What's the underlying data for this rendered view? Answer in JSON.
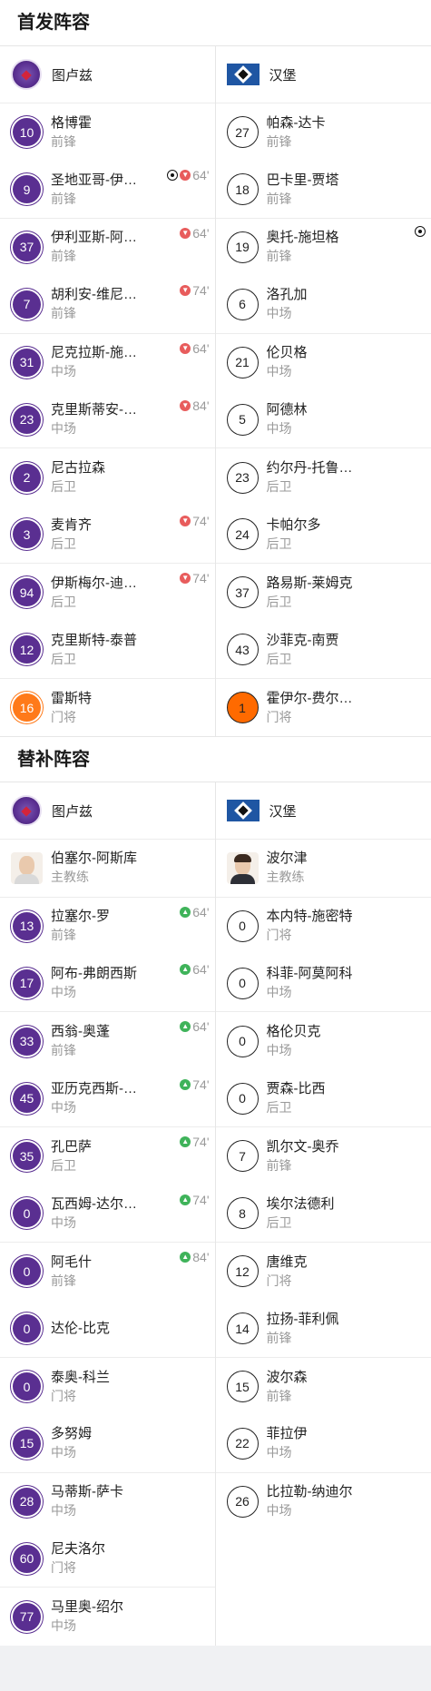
{
  "starting": {
    "title": "首发阵容",
    "home": {
      "team": "图卢兹",
      "players": [
        {
          "num": "10",
          "name": "格博霍",
          "pos": "前锋",
          "events": []
        },
        {
          "num": "9",
          "name": "圣地亚哥-伊…",
          "pos": "前锋",
          "events": [
            "goal",
            "sub_out"
          ],
          "minute": "64'"
        },
        {
          "num": "37",
          "name": "伊利亚斯-阿…",
          "pos": "前锋",
          "events": [
            "sub_out"
          ],
          "minute": "64'"
        },
        {
          "num": "7",
          "name": "胡利安-维尼…",
          "pos": "前锋",
          "events": [
            "sub_out"
          ],
          "minute": "74'"
        },
        {
          "num": "31",
          "name": "尼克拉斯-施…",
          "pos": "中场",
          "events": [
            "sub_out"
          ],
          "minute": "64'"
        },
        {
          "num": "23",
          "name": "克里斯蒂安-…",
          "pos": "中场",
          "events": [
            "sub_out"
          ],
          "minute": "84'"
        },
        {
          "num": "2",
          "name": "尼古拉森",
          "pos": "后卫",
          "events": []
        },
        {
          "num": "3",
          "name": "麦肯齐",
          "pos": "后卫",
          "events": [
            "sub_out"
          ],
          "minute": "74'"
        },
        {
          "num": "94",
          "name": "伊斯梅尔-迪…",
          "pos": "后卫",
          "events": [
            "sub_out"
          ],
          "minute": "74'"
        },
        {
          "num": "12",
          "name": "克里斯特-泰普",
          "pos": "后卫",
          "events": []
        },
        {
          "num": "16",
          "name": "雷斯特",
          "pos": "门将",
          "events": [],
          "gk": true
        }
      ]
    },
    "away": {
      "team": "汉堡",
      "players": [
        {
          "num": "27",
          "name": "帕森-达卡",
          "pos": "前锋",
          "events": []
        },
        {
          "num": "18",
          "name": "巴卡里-贾塔",
          "pos": "前锋",
          "events": []
        },
        {
          "num": "19",
          "name": "奥托-施坦格",
          "pos": "前锋",
          "events": [
            "goal"
          ]
        },
        {
          "num": "6",
          "name": "洛孔加",
          "pos": "中场",
          "events": []
        },
        {
          "num": "21",
          "name": "伦贝格",
          "pos": "中场",
          "events": []
        },
        {
          "num": "5",
          "name": "阿德林",
          "pos": "中场",
          "events": []
        },
        {
          "num": "23",
          "name": "约尔丹-托鲁…",
          "pos": "后卫",
          "events": []
        },
        {
          "num": "24",
          "name": "卡帕尔多",
          "pos": "后卫",
          "events": []
        },
        {
          "num": "37",
          "name": "路易斯-莱姆克",
          "pos": "后卫",
          "events": []
        },
        {
          "num": "43",
          "name": "沙菲克-南贾",
          "pos": "后卫",
          "events": []
        },
        {
          "num": "1",
          "name": "霍伊尔-费尔…",
          "pos": "门将",
          "events": [],
          "gk": true
        }
      ]
    }
  },
  "subs": {
    "title": "替补阵容",
    "home": {
      "team": "图卢兹",
      "coach": {
        "name": "伯塞尔-阿斯库",
        "role": "主教练"
      },
      "players": [
        {
          "num": "13",
          "name": "拉塞尔-罗",
          "pos": "前锋",
          "events": [
            "sub_in"
          ],
          "minute": "64'"
        },
        {
          "num": "17",
          "name": "阿布-弗朗西斯",
          "pos": "中场",
          "events": [
            "sub_in"
          ],
          "minute": "64'"
        },
        {
          "num": "33",
          "name": "西翁-奥蓬",
          "pos": "前锋",
          "events": [
            "sub_in"
          ],
          "minute": "64'"
        },
        {
          "num": "45",
          "name": "亚历克西斯-…",
          "pos": "中场",
          "events": [
            "sub_in"
          ],
          "minute": "74'"
        },
        {
          "num": "35",
          "name": "孔巴萨",
          "pos": "后卫",
          "events": [
            "sub_in"
          ],
          "minute": "74'"
        },
        {
          "num": "0",
          "name": "瓦西姆-达尔…",
          "pos": "中场",
          "events": [
            "sub_in"
          ],
          "minute": "74'"
        },
        {
          "num": "0",
          "name": "阿毛什",
          "pos": "前锋",
          "events": [
            "sub_in"
          ],
          "minute": "84'"
        },
        {
          "num": "0",
          "name": "达伦-比克",
          "pos": "",
          "events": []
        },
        {
          "num": "0",
          "name": "泰奥-科兰",
          "pos": "门将",
          "events": []
        },
        {
          "num": "15",
          "name": "多努姆",
          "pos": "中场",
          "events": []
        },
        {
          "num": "28",
          "name": "马蒂斯-萨卡",
          "pos": "中场",
          "events": []
        },
        {
          "num": "60",
          "name": "尼夫洛尔",
          "pos": "门将",
          "events": []
        },
        {
          "num": "77",
          "name": "马里奥-绍尔",
          "pos": "中场",
          "events": []
        }
      ]
    },
    "away": {
      "team": "汉堡",
      "coach": {
        "name": "波尔津",
        "role": "主教练"
      },
      "players": [
        {
          "num": "0",
          "name": "本内特-施密特",
          "pos": "门将",
          "events": []
        },
        {
          "num": "0",
          "name": "科菲-阿莫阿科",
          "pos": "中场",
          "events": []
        },
        {
          "num": "0",
          "name": "格伦贝克",
          "pos": "中场",
          "events": []
        },
        {
          "num": "0",
          "name": "贾森-比西",
          "pos": "后卫",
          "events": []
        },
        {
          "num": "7",
          "name": "凯尔文-奥乔",
          "pos": "前锋",
          "events": []
        },
        {
          "num": "8",
          "name": "埃尔法德利",
          "pos": "后卫",
          "events": []
        },
        {
          "num": "12",
          "name": "唐维克",
          "pos": "门将",
          "events": []
        },
        {
          "num": "14",
          "name": "拉扬-菲利佩",
          "pos": "前锋",
          "events": []
        },
        {
          "num": "15",
          "name": "波尔森",
          "pos": "前锋",
          "events": []
        },
        {
          "num": "22",
          "name": "菲拉伊",
          "pos": "中场",
          "events": []
        },
        {
          "num": "26",
          "name": "比拉勒-纳迪尔",
          "pos": "中场",
          "events": []
        }
      ]
    }
  }
}
